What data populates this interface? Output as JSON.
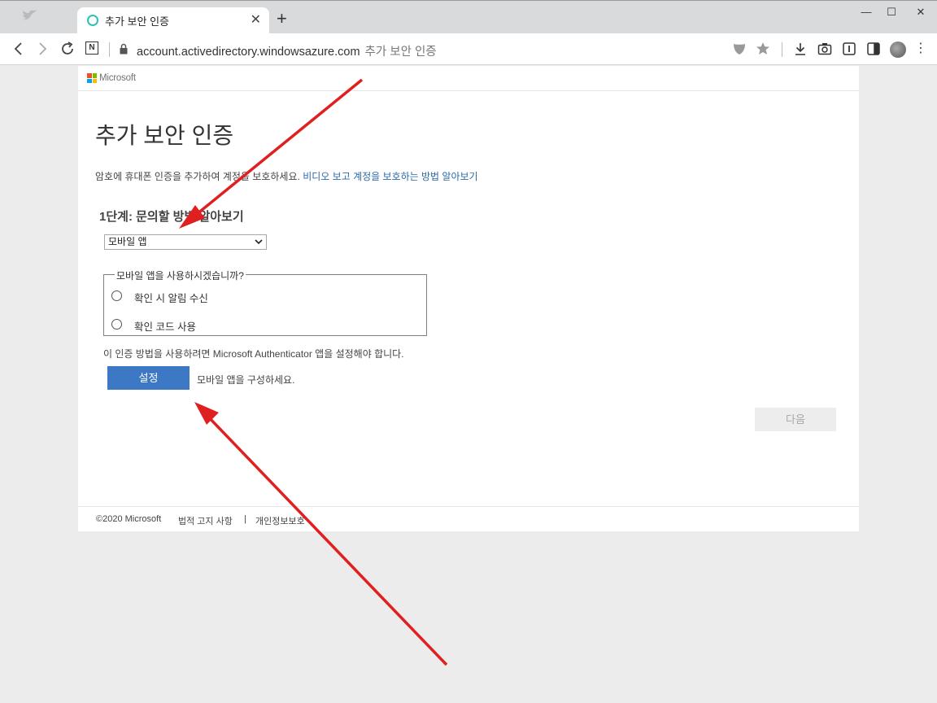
{
  "browser": {
    "tab_title": "추가 보안 인증",
    "tab_close": "✕",
    "new_tab": "+",
    "window_controls": {
      "minimize": "—",
      "maximize": "☐",
      "close": "✕"
    },
    "url": "account.activedirectory.windowsazure.com",
    "url_page_title": "추가 보안 인증",
    "icons": [
      "back-icon",
      "forward-icon",
      "reload-icon",
      "notion-icon",
      "lock-icon",
      "shield-icon",
      "star-icon",
      "download-icon",
      "camera-icon",
      "reader-icon",
      "sidebar-icon",
      "avatar",
      "menu-icon"
    ],
    "accent_color": "#2bc3b6"
  },
  "page": {
    "brand": "Microsoft",
    "title": "추가 보안 인증",
    "intro_text": "암호에 휴대폰 인증을 추가하여 계정을 보호하세요.",
    "intro_link": "비디오 보고 계정을 보호하는 방법 알아보기",
    "step_heading": "1단계: 문의할 방법 알아보기",
    "method_select": {
      "selected": "모바일 앱"
    },
    "mobile_app_group": {
      "legend": "모바일 앱을 사용하시겠습니까?",
      "options": [
        {
          "label": "확인 시 알림 수신",
          "checked": false
        },
        {
          "label": "확인 코드 사용",
          "checked": false
        }
      ]
    },
    "note": "이 인증 방법을 사용하려면 Microsoft Authenticator 앱을 설정해야 합니다.",
    "setup_button": "설정",
    "setup_description": "모바일 앱을 구성하세요.",
    "next_button": "다음",
    "primary_color": "#3d78c4"
  },
  "footer": {
    "copyright": "©2020 Microsoft",
    "legal": "법적 고지 사항",
    "divider": "|",
    "privacy": "개인정보보호"
  },
  "annotations": {
    "arrow_color": "#e02020"
  }
}
